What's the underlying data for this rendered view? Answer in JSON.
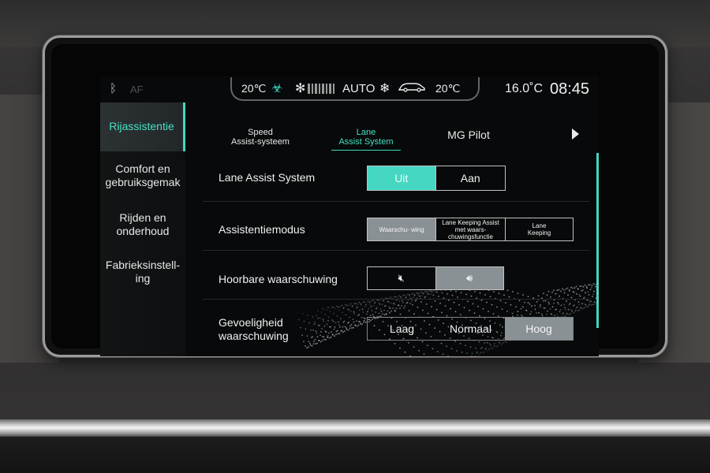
{
  "status": {
    "af": "AF",
    "temp_left": "20℃",
    "auto": "AUTO",
    "temp_right": "20℃",
    "outside_temp": "16.0˚℃",
    "outside_temp_display": "16.0˚C",
    "time": "08:45"
  },
  "sidebar": {
    "items": [
      {
        "label": "Rijassistentie"
      },
      {
        "label": "Comfort en gebruiksgemak"
      },
      {
        "label": "Rijden en onderhoud"
      },
      {
        "label": "Fabrieksinstell- ing"
      }
    ]
  },
  "tabs": {
    "items": [
      {
        "line1": "Speed",
        "line2": "Assist-systeem"
      },
      {
        "line1": "Lane",
        "line2": "Assist System"
      },
      {
        "label": "MG Pilot"
      }
    ]
  },
  "rows": {
    "lane": {
      "label": "Lane Assist System",
      "options": [
        "Uit",
        "Aan"
      ],
      "selected": "Uit"
    },
    "mode": {
      "label": "Assistentiemodus",
      "options": [
        "Waarschu- wing",
        "Lane Keeping Assist met waars- chuwingsfunctie",
        "Lane Keeping"
      ],
      "selected": "Waarschu- wing"
    },
    "audible": {
      "label": "Hoorbare waarschuwing",
      "options": [
        "mute-icon",
        "speaker-icon"
      ],
      "selected": "speaker-icon"
    },
    "sensitivity": {
      "label_line1": "Gevoeligheid",
      "label_line2": "waarschuwing",
      "options": [
        "Laag",
        "Normaal",
        "Hoog"
      ],
      "selected": "Hoog"
    }
  },
  "colors": {
    "accent": "#46e0c4",
    "selected_grey": "#8a9195"
  }
}
